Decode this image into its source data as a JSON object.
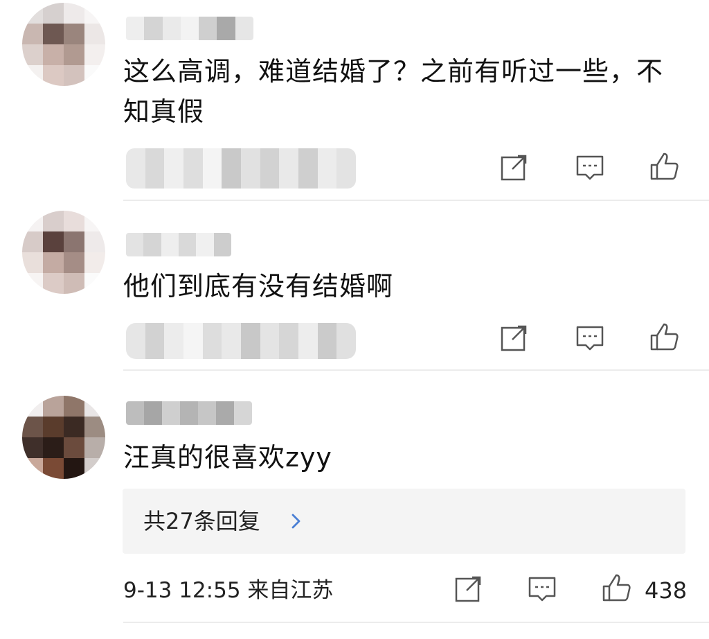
{
  "comments": [
    {
      "text": "这么高调，难道结婚了？之前有听过一些，不知真假"
    },
    {
      "text": "他们到底有没有结婚啊"
    },
    {
      "text": "汪真的很喜欢zyy",
      "replies_label": "共27条回复",
      "meta": "9-13 12:55 来自江苏",
      "like_count": "438"
    }
  ],
  "icons": {
    "share": "share-icon",
    "comment": "comment-icon",
    "like": "thumbs-up-icon",
    "chevron": "chevron-right-icon"
  },
  "colors": {
    "text": "#111111",
    "icon": "#555555",
    "chevron": "#4a7fd4",
    "reply_bg": "#f4f4f4",
    "divider": "#ececec"
  }
}
